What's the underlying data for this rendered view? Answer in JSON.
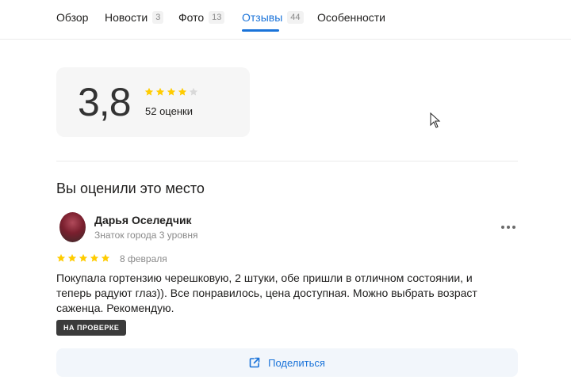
{
  "tabs": [
    {
      "label": "Обзор"
    },
    {
      "label": "Новости",
      "count": "3"
    },
    {
      "label": "Фото",
      "count": "13"
    },
    {
      "label": "Отзывы",
      "count": "44",
      "active": true
    },
    {
      "label": "Особенности"
    }
  ],
  "rating": {
    "value": "3,8",
    "stars_filled": 4,
    "stars_total": 5,
    "count_label": "52 оценки"
  },
  "section": {
    "title": "Вы оценили это место"
  },
  "review": {
    "author": "Дарья Оселедчик",
    "level": "Знаток города 3 уровня",
    "stars_filled": 5,
    "date": "8 февраля",
    "text": "Покупала гортензию черешковую, 2 штуки, обе пришли в отличном состоянии, и теперь радуют глаз)). Все понравилось, цена доступная. Можно выбрать возраст саженца. Рекомендую.",
    "status": "НА ПРОВЕРКЕ",
    "share_label": "Поделиться"
  },
  "colors": {
    "accent": "#1a73d9",
    "star_filled": "#fc0",
    "star_empty": "#d9d9d9",
    "badge_bg": "#3b3b3b"
  }
}
